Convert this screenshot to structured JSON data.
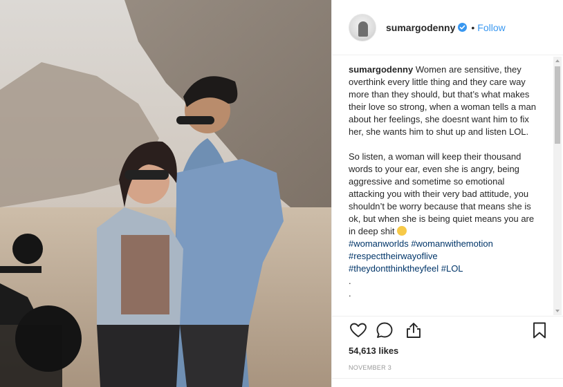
{
  "post": {
    "username": "sumargodenny",
    "separator": "•",
    "follow_label": "Follow",
    "verified_icon": "verified-badge-icon",
    "accent_color": "#3897f0",
    "hashtag_color": "#003569"
  },
  "caption": {
    "author": "sumargodenny",
    "paragraph1": "Women are sensitive, they overthink every little thing and they care way more than they should, but that’s what makes their love so strong, when a woman tells a man about her feelings, she doesnt want him to fix her, she wants him to shut up and listen LOL.",
    "paragraph2": "So listen, a woman will keep their thousand words to your ear, even she is angry, being aggressive and sometime so emotional attacking you with their very bad attitude, you shouldn’t be worry because that means she is ok, but when she is being quiet means you are in deep shit",
    "emoji": "grimacing-face-emoji",
    "hashtags_line1": "#womanworlds #womanwithemotion",
    "hashtags_line2": "#respecttheirwayoflive",
    "hashtags_line3": "#theydontthinktheyfeel",
    "hashtag_lol": "#LOL",
    "dot1": ".",
    "dot2": "."
  },
  "actions": {
    "like_icon": "heart-icon",
    "comment_icon": "comment-icon",
    "share_icon": "share-icon",
    "save_icon": "bookmark-icon"
  },
  "likes_text": "54,613 likes",
  "date_text": "NOVEMBER 3"
}
